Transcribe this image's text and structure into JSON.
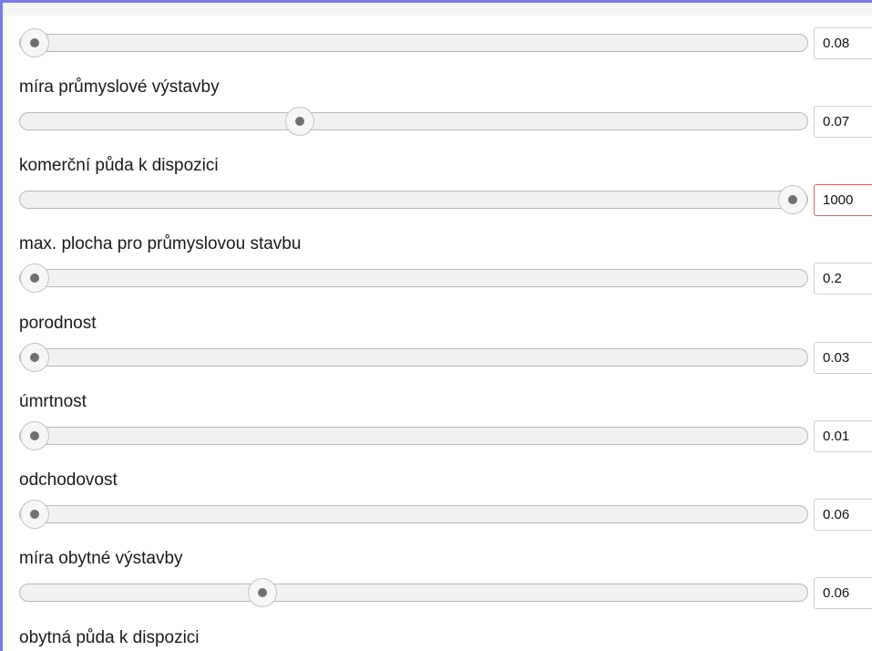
{
  "colors": {
    "frame_border": "#7b7fd6",
    "invalid_border": "#e06060",
    "thumb_dot": "#707070"
  },
  "sliders": [
    {
      "label": "",
      "value": "0.08",
      "position": 0.0,
      "invalid": false
    },
    {
      "label": "míra průmyslové výstavby",
      "value": "0.07",
      "position": 0.35,
      "invalid": false
    },
    {
      "label": "komerční půda k dispozici",
      "value": "1000",
      "position": 1.0,
      "invalid": true
    },
    {
      "label": "max. plocha pro průmyslovou stavbu",
      "value": "0.2",
      "position": 0.0,
      "invalid": false
    },
    {
      "label": "porodnost",
      "value": "0.03",
      "position": 0.0,
      "invalid": false
    },
    {
      "label": "úmrtnost",
      "value": "0.01",
      "position": 0.0,
      "invalid": false
    },
    {
      "label": "odchodovost",
      "value": "0.06",
      "position": 0.0,
      "invalid": false
    },
    {
      "label": "míra obytné výstavby",
      "value": "0.06",
      "position": 0.3,
      "invalid": false
    }
  ],
  "trailing_label": "obytná půda k dispozici"
}
